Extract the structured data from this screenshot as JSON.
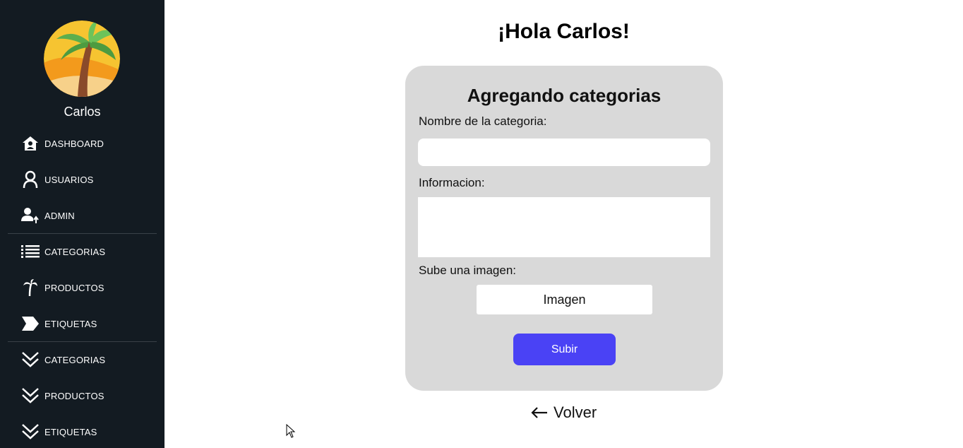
{
  "sidebar": {
    "username": "Carlos",
    "items": [
      {
        "label": "DASHBOARD",
        "icon": "home-user-icon"
      },
      {
        "label": "USUARIOS",
        "icon": "user-icon"
      },
      {
        "label": "ADMIN",
        "icon": "admin-up-icon"
      },
      {
        "label": "CATEGORIAS",
        "icon": "list-icon"
      },
      {
        "label": "PRODUCTOS",
        "icon": "palm-tree-icon"
      },
      {
        "label": "ETIQUETAS",
        "icon": "tag-arrow-icon"
      },
      {
        "label": "CATEGORIAS",
        "icon": "double-chevron-down-icon"
      },
      {
        "label": "PRODUCTOS",
        "icon": "double-chevron-down-icon"
      },
      {
        "label": "ETIQUETAS",
        "icon": "double-chevron-down-icon"
      }
    ]
  },
  "main": {
    "greeting": "¡Hola Carlos!",
    "form": {
      "title": "Agregando categorias",
      "name_label": "Nombre de la categoria:",
      "name_value": "",
      "info_label": "Informacion:",
      "info_value": "",
      "image_label": "Sube una imagen:",
      "image_button": "Imagen",
      "submit_label": "Subir"
    },
    "back_label": "Volver"
  },
  "colors": {
    "sidebar_bg": "#131b22",
    "card_bg": "#d9d9d9",
    "submit_bg": "#4a42f5"
  }
}
